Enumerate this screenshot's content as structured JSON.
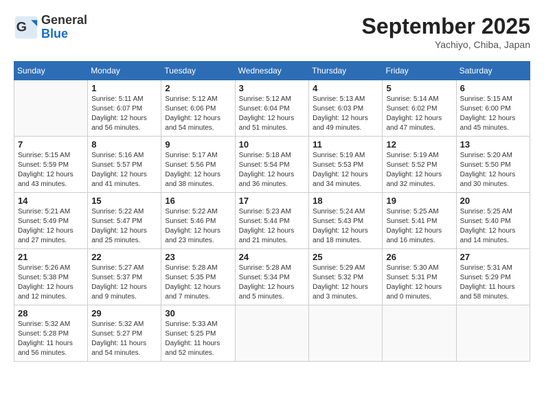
{
  "logo": {
    "general": "General",
    "blue": "Blue"
  },
  "title": {
    "month_year": "September 2025",
    "location": "Yachiyo, Chiba, Japan"
  },
  "days_of_week": [
    "Sunday",
    "Monday",
    "Tuesday",
    "Wednesday",
    "Thursday",
    "Friday",
    "Saturday"
  ],
  "weeks": [
    [
      {
        "day": "",
        "sunrise": "",
        "sunset": "",
        "daylight": ""
      },
      {
        "day": "1",
        "sunrise": "Sunrise: 5:11 AM",
        "sunset": "Sunset: 6:07 PM",
        "daylight": "Daylight: 12 hours and 56 minutes."
      },
      {
        "day": "2",
        "sunrise": "Sunrise: 5:12 AM",
        "sunset": "Sunset: 6:06 PM",
        "daylight": "Daylight: 12 hours and 54 minutes."
      },
      {
        "day": "3",
        "sunrise": "Sunrise: 5:12 AM",
        "sunset": "Sunset: 6:04 PM",
        "daylight": "Daylight: 12 hours and 51 minutes."
      },
      {
        "day": "4",
        "sunrise": "Sunrise: 5:13 AM",
        "sunset": "Sunset: 6:03 PM",
        "daylight": "Daylight: 12 hours and 49 minutes."
      },
      {
        "day": "5",
        "sunrise": "Sunrise: 5:14 AM",
        "sunset": "Sunset: 6:02 PM",
        "daylight": "Daylight: 12 hours and 47 minutes."
      },
      {
        "day": "6",
        "sunrise": "Sunrise: 5:15 AM",
        "sunset": "Sunset: 6:00 PM",
        "daylight": "Daylight: 12 hours and 45 minutes."
      }
    ],
    [
      {
        "day": "7",
        "sunrise": "Sunrise: 5:15 AM",
        "sunset": "Sunset: 5:59 PM",
        "daylight": "Daylight: 12 hours and 43 minutes."
      },
      {
        "day": "8",
        "sunrise": "Sunrise: 5:16 AM",
        "sunset": "Sunset: 5:57 PM",
        "daylight": "Daylight: 12 hours and 41 minutes."
      },
      {
        "day": "9",
        "sunrise": "Sunrise: 5:17 AM",
        "sunset": "Sunset: 5:56 PM",
        "daylight": "Daylight: 12 hours and 38 minutes."
      },
      {
        "day": "10",
        "sunrise": "Sunrise: 5:18 AM",
        "sunset": "Sunset: 5:54 PM",
        "daylight": "Daylight: 12 hours and 36 minutes."
      },
      {
        "day": "11",
        "sunrise": "Sunrise: 5:19 AM",
        "sunset": "Sunset: 5:53 PM",
        "daylight": "Daylight: 12 hours and 34 minutes."
      },
      {
        "day": "12",
        "sunrise": "Sunrise: 5:19 AM",
        "sunset": "Sunset: 5:52 PM",
        "daylight": "Daylight: 12 hours and 32 minutes."
      },
      {
        "day": "13",
        "sunrise": "Sunrise: 5:20 AM",
        "sunset": "Sunset: 5:50 PM",
        "daylight": "Daylight: 12 hours and 30 minutes."
      }
    ],
    [
      {
        "day": "14",
        "sunrise": "Sunrise: 5:21 AM",
        "sunset": "Sunset: 5:49 PM",
        "daylight": "Daylight: 12 hours and 27 minutes."
      },
      {
        "day": "15",
        "sunrise": "Sunrise: 5:22 AM",
        "sunset": "Sunset: 5:47 PM",
        "daylight": "Daylight: 12 hours and 25 minutes."
      },
      {
        "day": "16",
        "sunrise": "Sunrise: 5:22 AM",
        "sunset": "Sunset: 5:46 PM",
        "daylight": "Daylight: 12 hours and 23 minutes."
      },
      {
        "day": "17",
        "sunrise": "Sunrise: 5:23 AM",
        "sunset": "Sunset: 5:44 PM",
        "daylight": "Daylight: 12 hours and 21 minutes."
      },
      {
        "day": "18",
        "sunrise": "Sunrise: 5:24 AM",
        "sunset": "Sunset: 5:43 PM",
        "daylight": "Daylight: 12 hours and 18 minutes."
      },
      {
        "day": "19",
        "sunrise": "Sunrise: 5:25 AM",
        "sunset": "Sunset: 5:41 PM",
        "daylight": "Daylight: 12 hours and 16 minutes."
      },
      {
        "day": "20",
        "sunrise": "Sunrise: 5:25 AM",
        "sunset": "Sunset: 5:40 PM",
        "daylight": "Daylight: 12 hours and 14 minutes."
      }
    ],
    [
      {
        "day": "21",
        "sunrise": "Sunrise: 5:26 AM",
        "sunset": "Sunset: 5:38 PM",
        "daylight": "Daylight: 12 hours and 12 minutes."
      },
      {
        "day": "22",
        "sunrise": "Sunrise: 5:27 AM",
        "sunset": "Sunset: 5:37 PM",
        "daylight": "Daylight: 12 hours and 9 minutes."
      },
      {
        "day": "23",
        "sunrise": "Sunrise: 5:28 AM",
        "sunset": "Sunset: 5:35 PM",
        "daylight": "Daylight: 12 hours and 7 minutes."
      },
      {
        "day": "24",
        "sunrise": "Sunrise: 5:28 AM",
        "sunset": "Sunset: 5:34 PM",
        "daylight": "Daylight: 12 hours and 5 minutes."
      },
      {
        "day": "25",
        "sunrise": "Sunrise: 5:29 AM",
        "sunset": "Sunset: 5:32 PM",
        "daylight": "Daylight: 12 hours and 3 minutes."
      },
      {
        "day": "26",
        "sunrise": "Sunrise: 5:30 AM",
        "sunset": "Sunset: 5:31 PM",
        "daylight": "Daylight: 12 hours and 0 minutes."
      },
      {
        "day": "27",
        "sunrise": "Sunrise: 5:31 AM",
        "sunset": "Sunset: 5:29 PM",
        "daylight": "Daylight: 11 hours and 58 minutes."
      }
    ],
    [
      {
        "day": "28",
        "sunrise": "Sunrise: 5:32 AM",
        "sunset": "Sunset: 5:28 PM",
        "daylight": "Daylight: 11 hours and 56 minutes."
      },
      {
        "day": "29",
        "sunrise": "Sunrise: 5:32 AM",
        "sunset": "Sunset: 5:27 PM",
        "daylight": "Daylight: 11 hours and 54 minutes."
      },
      {
        "day": "30",
        "sunrise": "Sunrise: 5:33 AM",
        "sunset": "Sunset: 5:25 PM",
        "daylight": "Daylight: 11 hours and 52 minutes."
      },
      {
        "day": "",
        "sunrise": "",
        "sunset": "",
        "daylight": ""
      },
      {
        "day": "",
        "sunrise": "",
        "sunset": "",
        "daylight": ""
      },
      {
        "day": "",
        "sunrise": "",
        "sunset": "",
        "daylight": ""
      },
      {
        "day": "",
        "sunrise": "",
        "sunset": "",
        "daylight": ""
      }
    ]
  ]
}
